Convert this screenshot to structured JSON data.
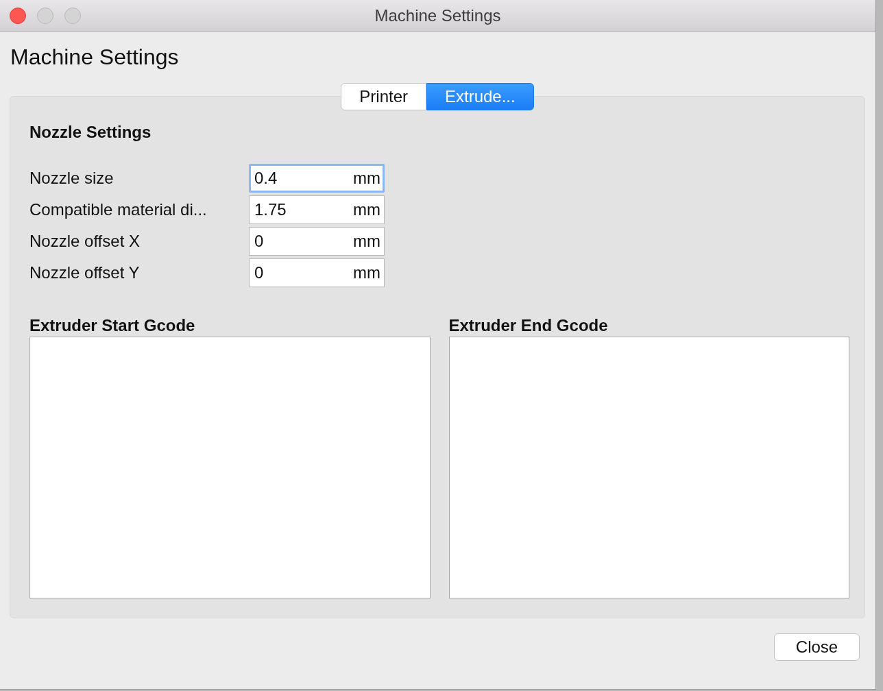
{
  "window": {
    "title": "Machine Settings"
  },
  "heading": "Machine Settings",
  "tabs": [
    {
      "label": "Printer",
      "selected": false
    },
    {
      "label": "Extrude...",
      "selected": true
    }
  ],
  "section_title": "Nozzle Settings",
  "fields": [
    {
      "label": "Nozzle size",
      "value": "0.4",
      "unit": "mm",
      "focused": true
    },
    {
      "label": "Compatible material di...",
      "value": "1.75",
      "unit": "mm",
      "focused": false
    },
    {
      "label": "Nozzle offset X",
      "value": "0",
      "unit": "mm",
      "focused": false
    },
    {
      "label": "Nozzle offset Y",
      "value": "0",
      "unit": "mm",
      "focused": false
    }
  ],
  "gcode": [
    {
      "title": "Extruder Start Gcode"
    },
    {
      "title": "Extruder End Gcode"
    }
  ],
  "buttons": [
    {
      "label": "Close"
    }
  ]
}
